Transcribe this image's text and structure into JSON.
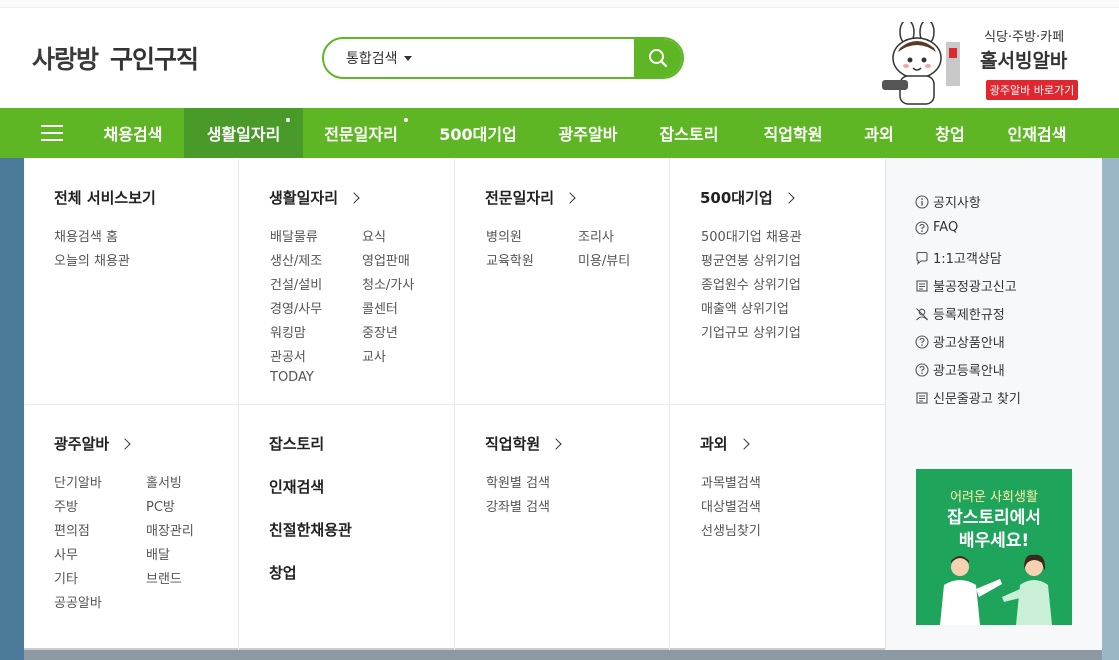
{
  "header": {
    "logo_mark": "사랑방",
    "logo_text": "구인구직",
    "search": {
      "category": "통합검색",
      "placeholder": ""
    },
    "ad": {
      "line1": "식당·주방·카페",
      "line2": "홀서빙알바",
      "button": "광주알바 바로가기"
    }
  },
  "nav": {
    "items": [
      "채용검색",
      "생활일자리",
      "전문일자리",
      "500대기업",
      "광주알바",
      "잡스토리",
      "직업학원",
      "과외",
      "창업",
      "인재검색"
    ],
    "active": "생활일자리"
  },
  "menu": {
    "all_services": {
      "title": "전체 서비스보기",
      "links": [
        "채용검색 홈",
        "오늘의 채용관"
      ]
    },
    "life_jobs": {
      "title": "생활일자리",
      "col1": [
        "배달물류",
        "생산/제조",
        "건설/설비",
        "경영/사무",
        "워킹맘",
        "관공서",
        "TODAY"
      ],
      "col2": [
        "요식",
        "영업판매",
        "청소/가사",
        "콜센터",
        "중장년",
        "교사"
      ]
    },
    "pro_jobs": {
      "title": "전문일자리",
      "col1": [
        "병의원",
        "교육학원"
      ],
      "col2": [
        "조리사",
        "미용/뷰티"
      ]
    },
    "top500": {
      "title": "500대기업",
      "links": [
        "500대기업 채용관",
        "평균연봉 상위기업",
        "종업원수 상위기업",
        "매출액 상위기업",
        "기업규모 상위기업"
      ]
    },
    "gwangju_alba": {
      "title": "광주알바",
      "col1": [
        "단기알바",
        "주방",
        "편의점",
        "사무",
        "기타",
        "공공알바"
      ],
      "col2": [
        "홀서빙",
        "PC방",
        "매장관리",
        "배달",
        "브랜드"
      ]
    },
    "misc": [
      "잡스토리",
      "인재검색",
      "친절한채용관",
      "창업"
    ],
    "academy": {
      "title": "직업학원",
      "links": [
        "학원별 검색",
        "강좌별 검색"
      ]
    },
    "tutoring": {
      "title": "과외",
      "links": [
        "과목별검색",
        "대상별검색",
        "선생님찾기"
      ]
    }
  },
  "side": {
    "links": [
      {
        "label": "공지사항",
        "icon": "info-circle-icon"
      },
      {
        "label": "FAQ",
        "icon": "question-circle-icon"
      },
      {
        "label": "1:1고객상담",
        "icon": "chat-bubble-icon"
      },
      {
        "label": "불공정광고신고",
        "icon": "report-doc-icon"
      },
      {
        "label": "등록제한규정",
        "icon": "user-block-icon"
      },
      {
        "label": "광고상품안내",
        "icon": "question-circle-icon"
      },
      {
        "label": "광고등록안내",
        "icon": "question-circle-icon"
      },
      {
        "label": "신문줄광고 찾기",
        "icon": "newspaper-icon"
      }
    ],
    "banner": {
      "line1": "어려운 사회생활",
      "line2": "잡스토리에서",
      "line3": "배우세요!"
    }
  },
  "colors": {
    "brand_green": "#5fb624",
    "active_green": "#4a9a2a",
    "ad_red": "#e0272f",
    "banner_green": "#1fa45b"
  }
}
